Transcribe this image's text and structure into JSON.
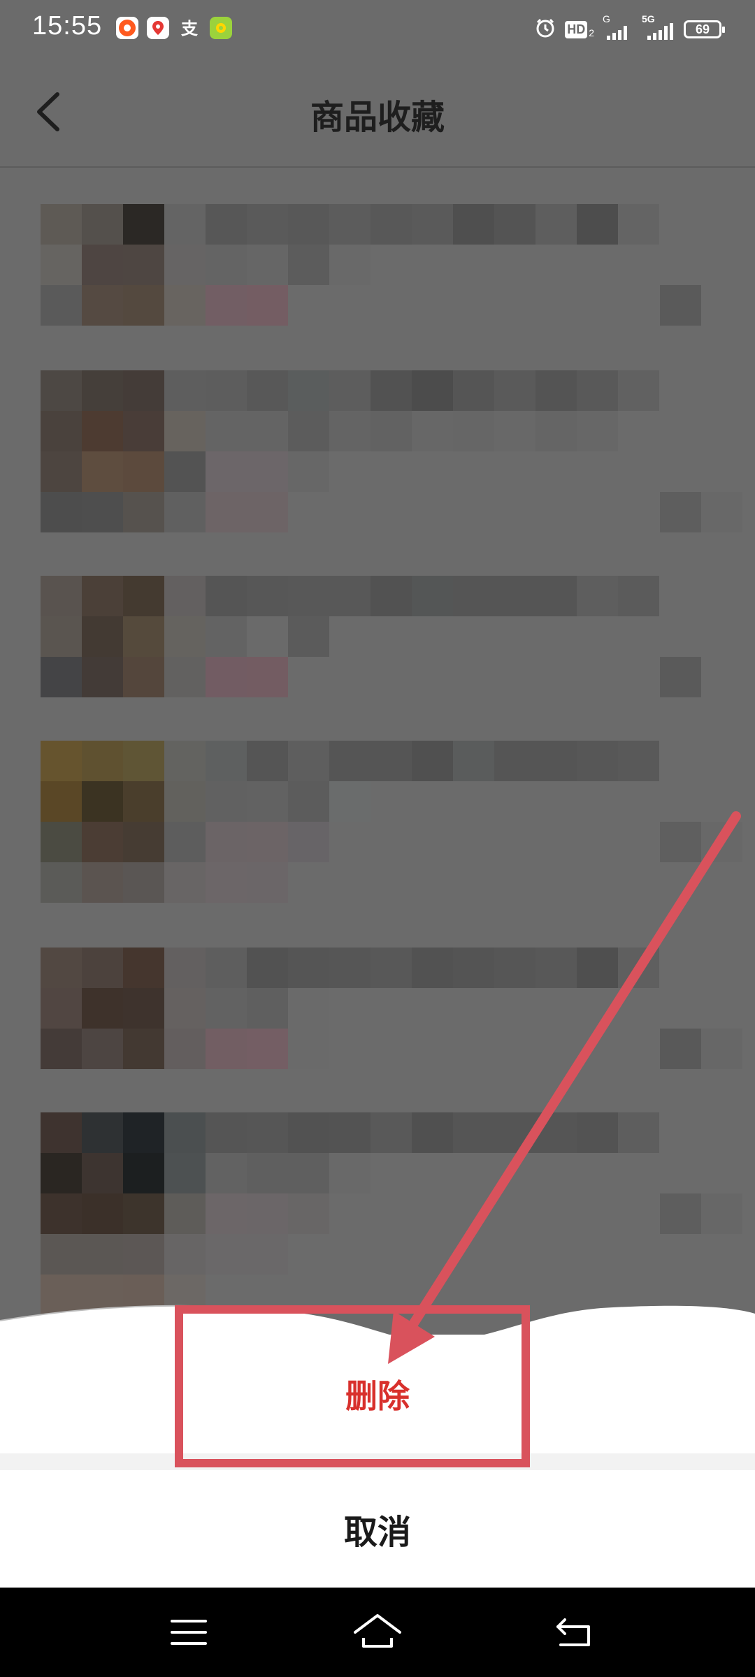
{
  "status_bar": {
    "time": "15:55",
    "app_icons": [
      "taobao-icon",
      "maps-icon",
      "alipay-icon",
      "wallet-icon"
    ],
    "hd_label": "HD",
    "hd_sub": "2",
    "signal_1_label": "G",
    "signal_2_label": "5G",
    "battery": "69"
  },
  "header": {
    "title": "商品收藏",
    "back_icon": "chevron-left-icon"
  },
  "content_background": "#6b6b6b",
  "action_sheet": {
    "delete_label": "删除",
    "cancel_label": "取消",
    "delete_color": "#d8302c"
  },
  "annotation": {
    "color": "#d9525c"
  },
  "nav_bar": {
    "menu_icon": "menu-icon",
    "home_icon": "home-icon",
    "back_icon": "back-icon"
  }
}
